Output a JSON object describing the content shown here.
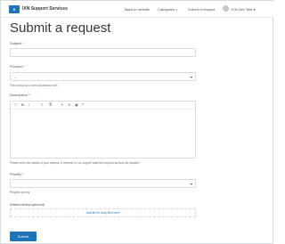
{
  "header": {
    "logo_text": "S",
    "brand": "IXN Support Services",
    "nav": {
      "back": "Back to website",
      "categories": "Categories",
      "submit_request": "Submit a request",
      "user": "IXN Dev Test"
    }
  },
  "page_title": "Submit a request",
  "form": {
    "subject_label": "Subject",
    "product_label": "Product",
    "product_value": "--",
    "product_hint": "The product you need assistance with",
    "description_label": "Description",
    "description_hint": "Please enter the details of your request. A member of our support staff will respond as soon as possible.",
    "priority_label": "Priority",
    "priority_value": "",
    "priority_hint": "Request priority",
    "attachments_label": "Attachments(optional)",
    "attachments_link": "Add file or drop files here",
    "required_mark": "*",
    "submit_label": "Submit"
  },
  "toolbar": {
    "text_format": "T",
    "bold": "B",
    "italic": "I",
    "bullets": "≡",
    "numbered": "≣",
    "link": "⚭",
    "code": "⊘",
    "image": "▣",
    "quote": "❝"
  }
}
